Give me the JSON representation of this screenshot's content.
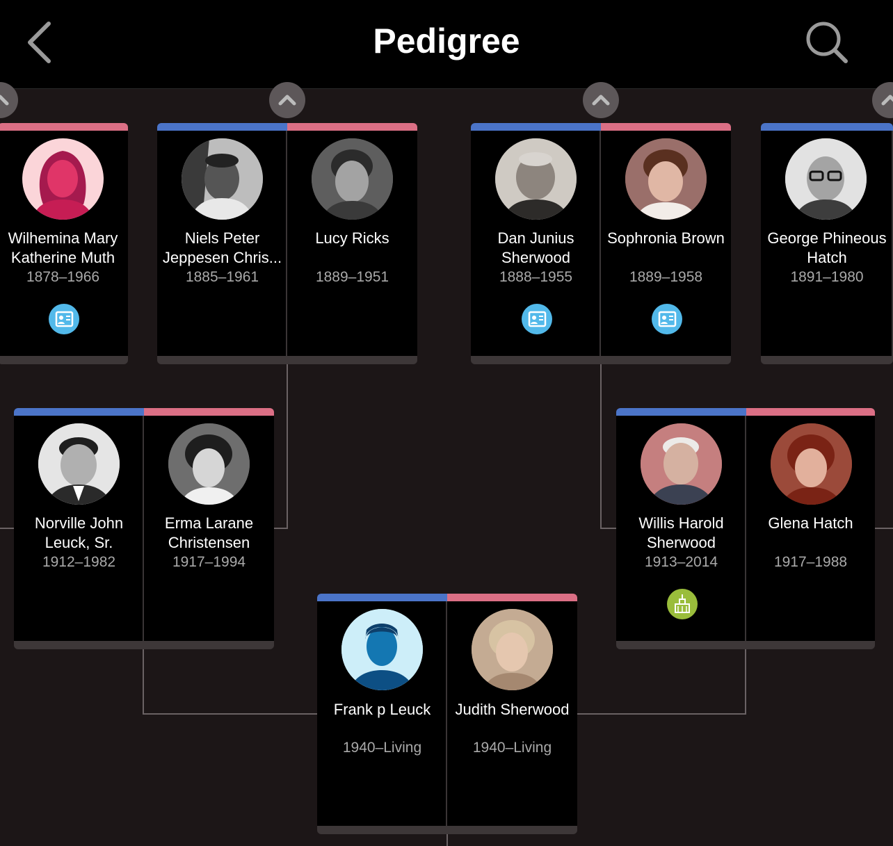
{
  "header": {
    "title": "Pedigree",
    "back_icon": "chevron-left-icon",
    "search_icon": "search-icon"
  },
  "colors": {
    "male": "#4b74c8",
    "female": "#db6f85",
    "record_badge": "#52b9ea",
    "temple_badge": "#9abd3b"
  },
  "people": {
    "wilhemina": {
      "name1": "Wilhemina Mary",
      "name2": "Katherine Muth",
      "dates": "1878–1966"
    },
    "niels": {
      "name1": "Niels Peter",
      "name2": "Jeppesen Chris...",
      "dates": "1885–1961"
    },
    "lucy": {
      "name1": "Lucy Ricks",
      "name2": "",
      "dates": "1889–1951"
    },
    "dan": {
      "name1": "Dan Junius",
      "name2": "Sherwood",
      "dates": "1888–1955"
    },
    "sophronia": {
      "name1": "Sophronia Brown",
      "name2": "",
      "dates": "1889–1958"
    },
    "george": {
      "name1": "George Phineous",
      "name2": "Hatch",
      "dates": "1891–1980"
    },
    "norville": {
      "name1": "Norville John",
      "name2": "Leuck, Sr.",
      "dates": "1912–1982"
    },
    "erma": {
      "name1": "Erma Larane",
      "name2": "Christensen",
      "dates": "1917–1994"
    },
    "willis": {
      "name1": "Willis Harold",
      "name2": "Sherwood",
      "dates": "1913–2014"
    },
    "glena": {
      "name1": "Glena Hatch",
      "name2": "",
      "dates": "1917–1988"
    },
    "frank": {
      "name1": "Frank p Leuck",
      "name2": "",
      "dates": "1940–Living"
    },
    "judith": {
      "name1": "Judith Sherwood",
      "name2": "",
      "dates": "1940–Living"
    }
  }
}
